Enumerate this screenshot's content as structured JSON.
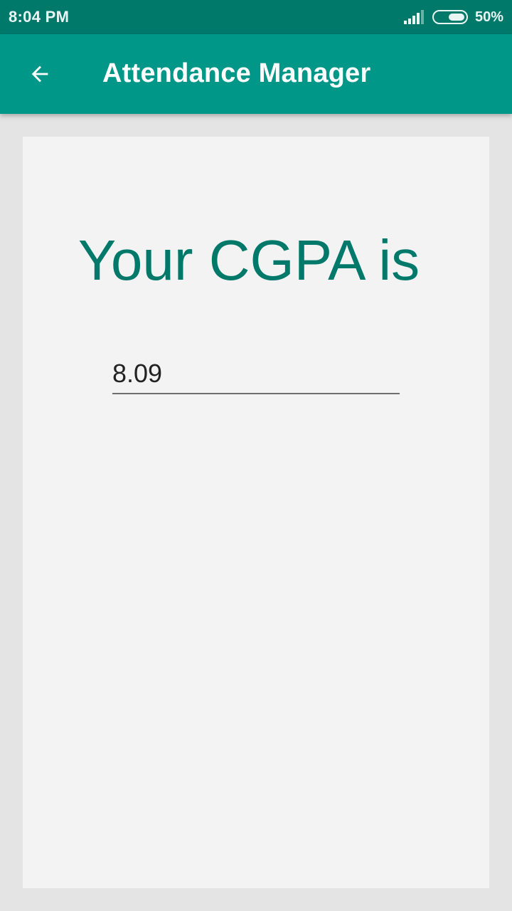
{
  "status_bar": {
    "time": "8:04 PM",
    "battery_percent": "50%",
    "signal_icon": "cellular-signal-icon",
    "battery_icon": "battery-icon",
    "battery_level": 0.5
  },
  "app_bar": {
    "title": "Attendance Manager",
    "back_icon": "arrow-back-icon",
    "color": "#009688"
  },
  "main": {
    "heading": "Your CGPA is",
    "cgpa_value": "8.09",
    "accent_color": "#00796b"
  }
}
